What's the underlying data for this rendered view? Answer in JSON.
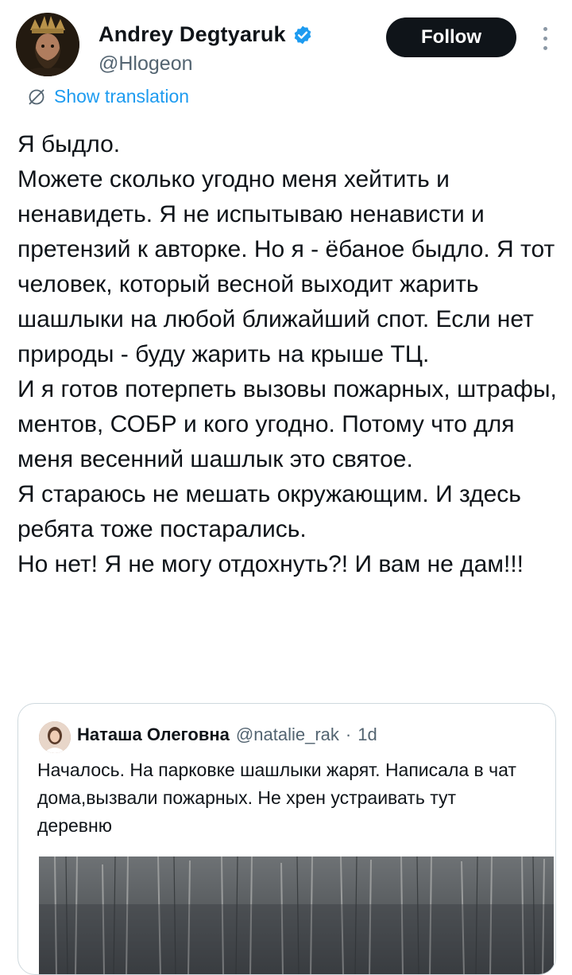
{
  "author": {
    "display_name": "Andrey Degtyaruk",
    "handle": "@Hlogeon",
    "verified": true,
    "avatar_icon": "crowned-portrait-avatar"
  },
  "actions": {
    "follow_label": "Follow",
    "more_icon": "vertical-ellipsis-icon"
  },
  "translation": {
    "label": "Show translation",
    "icon": "globe-slash-icon"
  },
  "post": {
    "text": "Я быдло.\nМожете сколько угодно меня хейтить и ненавидеть. Я не испытываю ненависти и претензий к авторке. Но я - ёбаное быдло. Я тот человек, который весной выходит жарить шашлыки на любой ближайший спот. Если нет природы - буду жарить на крыше ТЦ.\nИ я готов потерпеть вызовы пожарных, штрафы, ментов, СОБР и кого угодно. Потому что для меня весенний шашлык это святое.\nЯ стараюсь не мешать окружающим. И здесь ребята тоже постарались.\nНо нет! Я не могу отдохнуть?! И вам не дам!!!"
  },
  "quoted_post": {
    "display_name": "Наташа Олеговна",
    "handle": "@natalie_rak",
    "separator": "·",
    "time": "1d",
    "text": "Началось. На парковке шашлыки жарят. Написала в чат дома,вызвали пожарных. Не хрен устраивать тут деревню",
    "media": "birch-forest-photo"
  },
  "colors": {
    "text": "#0f1419",
    "secondary": "#536471",
    "accent": "#1d9bf0",
    "follow_bg": "#0f1419",
    "border": "#cfd9de"
  }
}
